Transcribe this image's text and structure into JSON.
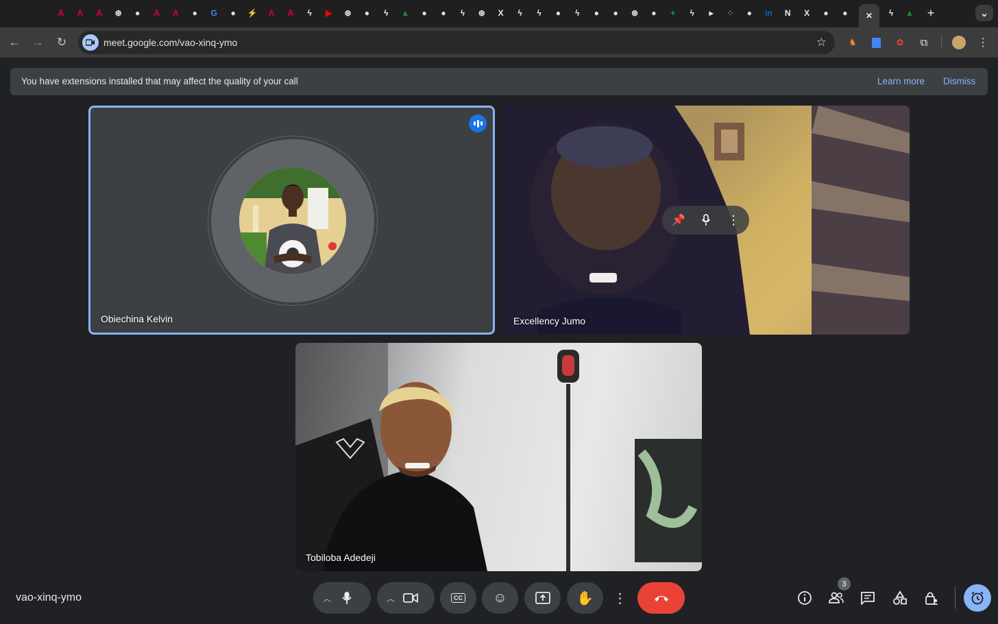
{
  "browser": {
    "url": "meet.google.com/vao-xinq-ymo",
    "tabs": [
      {
        "icon": "angular-icon",
        "glyph": "A",
        "color": "#dd0031"
      },
      {
        "icon": "angular-icon",
        "glyph": "A",
        "color": "#dd0031"
      },
      {
        "icon": "angular-icon",
        "glyph": "A",
        "color": "#dd0031"
      },
      {
        "icon": "openai-icon",
        "glyph": "⊛",
        "color": "#e8eaed"
      },
      {
        "icon": "github-icon",
        "glyph": "●",
        "color": "#e8eaed"
      },
      {
        "icon": "angular-icon",
        "glyph": "A",
        "color": "#dd0031"
      },
      {
        "icon": "angular-icon",
        "glyph": "A",
        "color": "#dd0031"
      },
      {
        "icon": "github-icon",
        "glyph": "●",
        "color": "#e8eaed"
      },
      {
        "icon": "google-icon",
        "glyph": "G",
        "color": "#4285f4"
      },
      {
        "icon": "github-icon",
        "glyph": "●",
        "color": "#e8eaed"
      },
      {
        "icon": "messenger-icon",
        "glyph": "⚡",
        "color": "#1877f2"
      },
      {
        "icon": "angular-icon",
        "glyph": "A",
        "color": "#dd0031"
      },
      {
        "icon": "angular-icon",
        "glyph": "A",
        "color": "#dd0031"
      },
      {
        "icon": "bolt-icon",
        "glyph": "ϟ",
        "color": "#e8eaed"
      },
      {
        "icon": "youtube-icon",
        "glyph": "▶",
        "color": "#ff0000"
      },
      {
        "icon": "openai-icon",
        "glyph": "⊛",
        "color": "#e8eaed"
      },
      {
        "icon": "github-icon",
        "glyph": "●",
        "color": "#e8eaed"
      },
      {
        "icon": "bolt-icon",
        "glyph": "ϟ",
        "color": "#e8eaed"
      },
      {
        "icon": "tree-icon",
        "glyph": "▲",
        "color": "#1e8e3e"
      },
      {
        "icon": "github-icon",
        "glyph": "●",
        "color": "#e8eaed"
      },
      {
        "icon": "github-icon",
        "glyph": "●",
        "color": "#e8eaed"
      },
      {
        "icon": "bolt-icon",
        "glyph": "ϟ",
        "color": "#e8eaed"
      },
      {
        "icon": "openai-icon",
        "glyph": "⊛",
        "color": "#e8eaed"
      },
      {
        "icon": "x-icon",
        "glyph": "X",
        "color": "#e8eaed"
      },
      {
        "icon": "bolt-icon",
        "glyph": "ϟ",
        "color": "#e8eaed"
      },
      {
        "icon": "bolt-icon",
        "glyph": "ϟ",
        "color": "#e8eaed"
      },
      {
        "icon": "github-icon",
        "glyph": "●",
        "color": "#e8eaed"
      },
      {
        "icon": "bolt-icon",
        "glyph": "ϟ",
        "color": "#e8eaed"
      },
      {
        "icon": "github-icon",
        "glyph": "●",
        "color": "#e8eaed"
      },
      {
        "icon": "github-icon",
        "glyph": "●",
        "color": "#e8eaed"
      },
      {
        "icon": "openai-icon",
        "glyph": "⊛",
        "color": "#e8eaed"
      },
      {
        "icon": "github-icon",
        "glyph": "●",
        "color": "#e8eaed"
      },
      {
        "icon": "sheets-icon",
        "glyph": "+",
        "color": "#0f9d58"
      },
      {
        "icon": "bolt-icon",
        "glyph": "ϟ",
        "color": "#e8eaed"
      },
      {
        "icon": "play-icon",
        "glyph": "▸",
        "color": "#e8eaed"
      },
      {
        "icon": "dots-icon",
        "glyph": "⁘",
        "color": "#34a853"
      },
      {
        "icon": "github-icon",
        "glyph": "●",
        "color": "#e8eaed"
      },
      {
        "icon": "linkedin-icon",
        "glyph": "in",
        "color": "#0a66c2"
      },
      {
        "icon": "notion-icon",
        "glyph": "N",
        "color": "#e8eaed"
      },
      {
        "icon": "x-icon",
        "glyph": "X",
        "color": "#e8eaed"
      },
      {
        "icon": "github-icon",
        "glyph": "●",
        "color": "#e8eaed"
      },
      {
        "icon": "github-icon",
        "glyph": "●",
        "color": "#e8eaed"
      }
    ],
    "active_tab_close": "✕",
    "trailing_tabs": [
      {
        "icon": "bolt-icon",
        "glyph": "ϟ",
        "color": "#e8eaed"
      },
      {
        "icon": "tree-icon",
        "glyph": "▲",
        "color": "#1e8e3e"
      }
    ],
    "new_tab": "+",
    "tab_search": "⌄"
  },
  "banner": {
    "text": "You have extensions installed that may affect the quality of your call",
    "learn_more": "Learn more",
    "dismiss": "Dismiss"
  },
  "participants": [
    {
      "name": "Obiechina Kelvin"
    },
    {
      "name": "Excellency Jumo"
    },
    {
      "name": "Tobiloba Adedeji"
    }
  ],
  "meeting_code": "vao-xinq-ymo",
  "people_count": "3"
}
